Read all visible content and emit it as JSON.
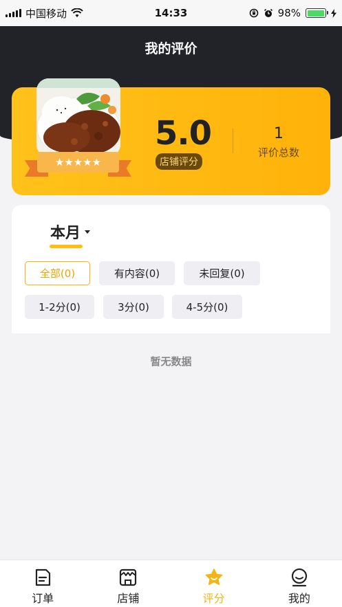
{
  "status_bar": {
    "carrier": "中国移动",
    "time": "14:33",
    "battery_percent": "98%",
    "battery_level": 0.98,
    "icons": [
      "signal-icon",
      "wifi-icon",
      "rotation-lock-icon",
      "alarm-icon",
      "battery-icon",
      "charging-icon"
    ]
  },
  "header": {
    "title": "我的评价"
  },
  "score_card": {
    "stars": "★★★★★",
    "star_count": 5,
    "score": "5.0",
    "score_label": "店铺评分",
    "total": "1",
    "total_label": "评价总数"
  },
  "filters": {
    "period": "本月",
    "chips": [
      "全部(0)",
      "有内容(0)",
      "未回复(0)",
      "1-2分(0)",
      "3分(0)",
      "4-5分(0)"
    ],
    "selected": "全部(0)"
  },
  "empty_text": "暂无数据",
  "tabs": [
    {
      "label": "订单",
      "icon": "order-icon"
    },
    {
      "label": "店铺",
      "icon": "store-icon"
    },
    {
      "label": "评分",
      "icon": "rating-icon"
    },
    {
      "label": "我的",
      "icon": "profile-icon"
    }
  ],
  "active_tab": "评分",
  "colors": {
    "accent": "#ffb20a",
    "header": "#222329",
    "background": "#f3f3f5"
  }
}
